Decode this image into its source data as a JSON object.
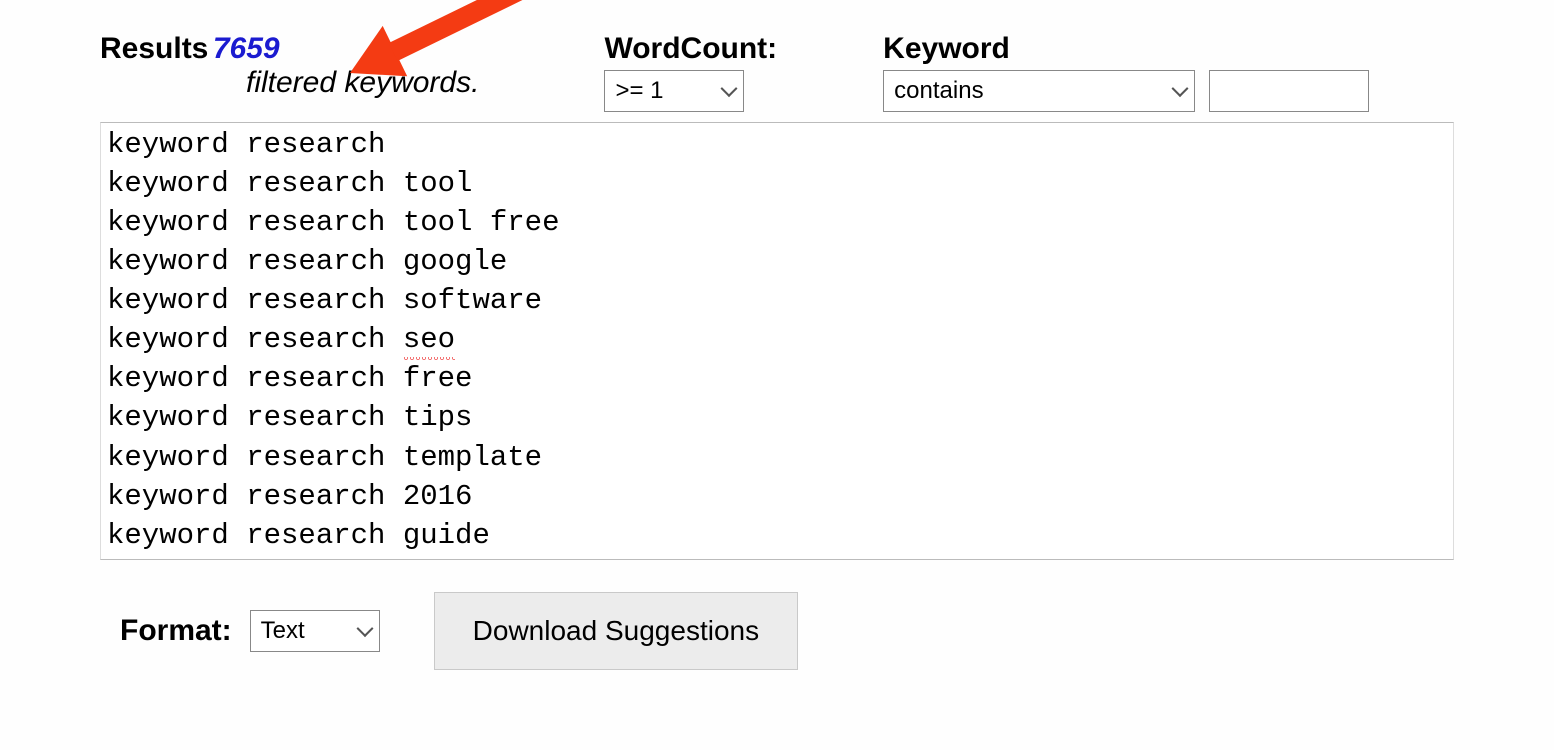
{
  "results": {
    "label": "Results",
    "count": "7659",
    "filtered_text": "filtered keywords."
  },
  "wordcount": {
    "label": "WordCount:",
    "selected": ">= 1"
  },
  "keyword": {
    "label": "Keyword",
    "mode_selected": "contains",
    "input_value": ""
  },
  "keywords_box": {
    "lines": [
      {
        "text": "keyword research",
        "spell": []
      },
      {
        "text": "keyword research tool",
        "spell": []
      },
      {
        "text": "keyword research tool free",
        "spell": []
      },
      {
        "text": "keyword research google",
        "spell": []
      },
      {
        "text": "keyword research software",
        "spell": []
      },
      {
        "text": "keyword research ",
        "spell": [
          "seo"
        ]
      },
      {
        "text": "keyword research free",
        "spell": []
      },
      {
        "text": "keyword research tips",
        "spell": []
      },
      {
        "text": "keyword research template",
        "spell": []
      },
      {
        "text": "keyword research 2016",
        "spell": []
      },
      {
        "text": "keyword research guide",
        "spell": []
      }
    ]
  },
  "footer": {
    "format_label": "Format:",
    "format_selected": "Text",
    "download_label": "Download Suggestions"
  }
}
